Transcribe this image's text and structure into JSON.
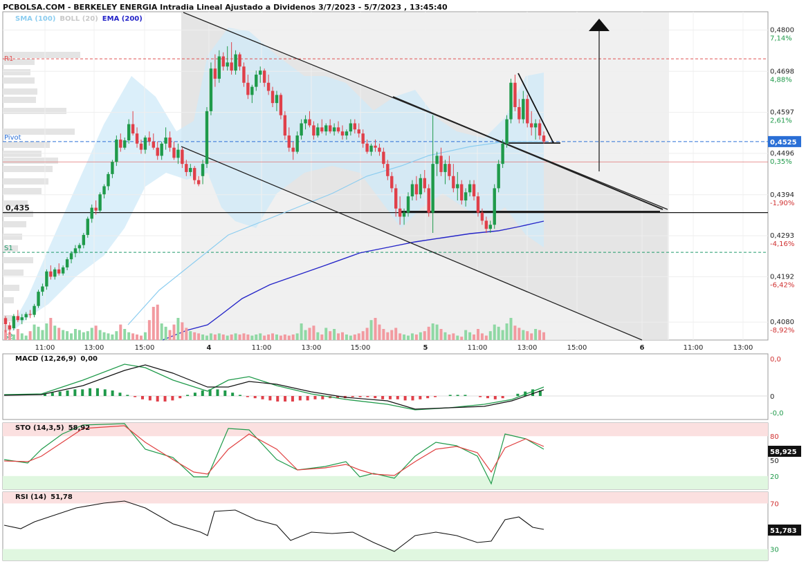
{
  "title": "PCBOLSA.COM - BERKELEY ENERGIA Intradia Lineal Ajustado a Dividenos 3/7/2023 - 5/7/2023 , 13:45:40",
  "legend": [
    {
      "label": "SMA (100)",
      "color": "#8ccdf0"
    },
    {
      "label": "BOLL (20)",
      "color": "#c8c8c8"
    },
    {
      "label": "EMA (200)",
      "color": "#2222cc"
    }
  ],
  "colors": {
    "up": "#1f9a4a",
    "down": "#e0404a",
    "sma": "#8ccdf0",
    "ema": "#2424c8",
    "pivot": "#2a6fd6",
    "r1": "#e05050",
    "s1": "#1f9a6a"
  },
  "chart_data": [
    {
      "type": "candlestick",
      "ylim": [
        0.4036,
        0.4845
      ],
      "y_ticks": [
        "0,4800",
        "0,4698",
        "0,4597",
        "0,4496",
        "0,4394",
        "0,4293",
        "0,4192",
        "0,4080"
      ],
      "percent_ticks": [
        "7,14%",
        "4,88%",
        "2,61%",
        "0,35%",
        "-1,90%",
        "-4,16%",
        "-6,42%",
        "-8,92%"
      ],
      "x_ticks": [
        "11:00",
        "13:00",
        "15:00",
        "4",
        "11:00",
        "13:00",
        "15:00",
        "5",
        "11:00",
        "13:00",
        "15:00",
        "6",
        "11:00",
        "13:00"
      ],
      "last_price": "0,4525",
      "levels": [
        {
          "label": "R1",
          "value": 0.4729
        },
        {
          "label": "Pivot",
          "value": 0.4525
        },
        {
          "label": "0,435",
          "value": 0.435
        },
        {
          "label": "S1",
          "value": 0.4252
        },
        {
          "label": "S2",
          "value": 0.4045
        }
      ],
      "ohlc": [
        [
          0.409,
          0.4095,
          0.4055,
          0.4075
        ],
        [
          0.4072,
          0.408,
          0.405,
          0.4062
        ],
        [
          0.4065,
          0.41,
          0.406,
          0.4095
        ],
        [
          0.4095,
          0.411,
          0.408,
          0.4085
        ],
        [
          0.4085,
          0.41,
          0.4075,
          0.4092
        ],
        [
          0.4092,
          0.4105,
          0.4085,
          0.41
        ],
        [
          0.41,
          0.411,
          0.409,
          0.4098
        ],
        [
          0.4098,
          0.4125,
          0.4092,
          0.412
        ],
        [
          0.412,
          0.416,
          0.4115,
          0.4155
        ],
        [
          0.4155,
          0.4175,
          0.4145,
          0.4168
        ],
        [
          0.4168,
          0.421,
          0.416,
          0.4205
        ],
        [
          0.4205,
          0.422,
          0.4185,
          0.4192
        ],
        [
          0.4192,
          0.4215,
          0.4185,
          0.421
        ],
        [
          0.421,
          0.4225,
          0.4195,
          0.42
        ],
        [
          0.42,
          0.422,
          0.4195,
          0.4215
        ],
        [
          0.4215,
          0.424,
          0.4208,
          0.4235
        ],
        [
          0.4235,
          0.4255,
          0.4225,
          0.425
        ],
        [
          0.425,
          0.427,
          0.424,
          0.4262
        ],
        [
          0.4262,
          0.4275,
          0.425,
          0.427
        ],
        [
          0.427,
          0.43,
          0.4262,
          0.4295
        ],
        [
          0.4295,
          0.434,
          0.4288,
          0.4335
        ],
        [
          0.4335,
          0.437,
          0.4325,
          0.4362
        ],
        [
          0.4362,
          0.438,
          0.4345,
          0.4355
        ],
        [
          0.4355,
          0.44,
          0.435,
          0.4395
        ],
        [
          0.4395,
          0.442,
          0.4385,
          0.4415
        ],
        [
          0.4415,
          0.445,
          0.4405,
          0.4445
        ],
        [
          0.4445,
          0.448,
          0.4435,
          0.4475
        ],
        [
          0.4475,
          0.454,
          0.4465,
          0.453
        ],
        [
          0.453,
          0.4545,
          0.45,
          0.451
        ],
        [
          0.451,
          0.4535,
          0.4505,
          0.4528
        ],
        [
          0.4528,
          0.458,
          0.452,
          0.4568
        ],
        [
          0.4568,
          0.46,
          0.454,
          0.4545
        ],
        [
          0.4545,
          0.456,
          0.451,
          0.452
        ],
        [
          0.452,
          0.453,
          0.4495,
          0.4505
        ],
        [
          0.4505,
          0.454,
          0.4495,
          0.4535
        ],
        [
          0.4535,
          0.455,
          0.4515,
          0.4525
        ],
        [
          0.4525,
          0.4545,
          0.4505,
          0.451
        ],
        [
          0.451,
          0.4525,
          0.448,
          0.449
        ],
        [
          0.449,
          0.4525,
          0.448,
          0.452
        ],
        [
          0.452,
          0.456,
          0.4505,
          0.4535
        ],
        [
          0.4535,
          0.455,
          0.45,
          0.451
        ],
        [
          0.451,
          0.4525,
          0.448,
          0.4485
        ],
        [
          0.4485,
          0.452,
          0.447,
          0.4505
        ],
        [
          0.4505,
          0.451,
          0.446,
          0.447
        ],
        [
          0.447,
          0.448,
          0.444,
          0.445
        ],
        [
          0.445,
          0.447,
          0.444,
          0.446
        ],
        [
          0.446,
          0.4465,
          0.442,
          0.443
        ],
        [
          0.443,
          0.444,
          0.4415,
          0.442
        ],
        [
          0.444,
          0.448,
          0.442,
          0.447
        ],
        [
          0.447,
          0.461,
          0.446,
          0.46
        ],
        [
          0.46,
          0.472,
          0.459,
          0.4705
        ],
        [
          0.4705,
          0.474,
          0.466,
          0.468
        ],
        [
          0.468,
          0.475,
          0.467,
          0.4735
        ],
        [
          0.4735,
          0.4745,
          0.47,
          0.471
        ],
        [
          0.471,
          0.476,
          0.47,
          0.472
        ],
        [
          0.472,
          0.477,
          0.469,
          0.47
        ],
        [
          0.47,
          0.475,
          0.469,
          0.474
        ],
        [
          0.474,
          0.4745,
          0.47,
          0.471
        ],
        [
          0.471,
          0.472,
          0.466,
          0.467
        ],
        [
          0.467,
          0.469,
          0.463,
          0.464
        ],
        [
          0.464,
          0.4665,
          0.462,
          0.466
        ],
        [
          0.466,
          0.47,
          0.465,
          0.469
        ],
        [
          0.469,
          0.471,
          0.467,
          0.47
        ],
        [
          0.47,
          0.4705,
          0.466,
          0.467
        ],
        [
          0.467,
          0.469,
          0.464,
          0.465
        ],
        [
          0.465,
          0.466,
          0.461,
          0.462
        ],
        [
          0.462,
          0.465,
          0.46,
          0.464
        ],
        [
          0.464,
          0.4645,
          0.458,
          0.459
        ],
        [
          0.459,
          0.46,
          0.453,
          0.454
        ],
        [
          0.454,
          0.456,
          0.45,
          0.451
        ],
        [
          0.451,
          0.4525,
          0.448,
          0.45
        ],
        [
          0.45,
          0.455,
          0.4495,
          0.454
        ],
        [
          0.454,
          0.458,
          0.453,
          0.457
        ],
        [
          0.457,
          0.459,
          0.4555,
          0.458
        ],
        [
          0.458,
          0.46,
          0.456,
          0.4565
        ],
        [
          0.4565,
          0.4575,
          0.453,
          0.454
        ],
        [
          0.454,
          0.457,
          0.4535,
          0.456
        ],
        [
          0.456,
          0.458,
          0.4545,
          0.455
        ],
        [
          0.455,
          0.457,
          0.454,
          0.4565
        ],
        [
          0.4565,
          0.458,
          0.4545,
          0.455
        ],
        [
          0.455,
          0.457,
          0.454,
          0.456
        ],
        [
          0.456,
          0.4575,
          0.4545,
          0.455
        ],
        [
          0.455,
          0.4565,
          0.453,
          0.454
        ],
        [
          0.454,
          0.4555,
          0.453,
          0.455
        ],
        [
          0.455,
          0.458,
          0.454,
          0.457
        ],
        [
          0.457,
          0.458,
          0.4545,
          0.4555
        ],
        [
          0.4555,
          0.457,
          0.4535,
          0.4545
        ],
        [
          0.4545,
          0.4555,
          0.451,
          0.452
        ],
        [
          0.452,
          0.453,
          0.4495,
          0.45
        ],
        [
          0.45,
          0.452,
          0.449,
          0.4515
        ],
        [
          0.4515,
          0.453,
          0.45,
          0.451
        ],
        [
          0.451,
          0.452,
          0.449,
          0.45
        ],
        [
          0.45,
          0.451,
          0.446,
          0.447
        ],
        [
          0.447,
          0.448,
          0.443,
          0.444
        ],
        [
          0.444,
          0.445,
          0.44,
          0.441
        ],
        [
          0.441,
          0.442,
          0.434,
          0.436
        ],
        [
          0.436,
          0.439,
          0.432,
          0.434
        ],
        [
          0.434,
          0.436,
          0.432,
          0.435
        ],
        [
          0.435,
          0.44,
          0.434,
          0.439
        ],
        [
          0.439,
          0.443,
          0.438,
          0.442
        ],
        [
          0.442,
          0.444,
          0.438,
          0.4395
        ],
        [
          0.4395,
          0.4445,
          0.4385,
          0.4435
        ],
        [
          0.4435,
          0.4455,
          0.44,
          0.441
        ],
        [
          0.441,
          0.442,
          0.434,
          0.435
        ],
        [
          0.435,
          0.459,
          0.43,
          0.447
        ],
        [
          0.447,
          0.45,
          0.444,
          0.449
        ],
        [
          0.449,
          0.451,
          0.444,
          0.445
        ],
        [
          0.445,
          0.448,
          0.442,
          0.447
        ],
        [
          0.447,
          0.449,
          0.443,
          0.444
        ],
        [
          0.444,
          0.447,
          0.44,
          0.441
        ],
        [
          0.441,
          0.445,
          0.438,
          0.442
        ],
        [
          0.442,
          0.443,
          0.437,
          0.438
        ],
        [
          0.438,
          0.441,
          0.4365,
          0.44
        ],
        [
          0.44,
          0.443,
          0.439,
          0.442
        ],
        [
          0.442,
          0.443,
          0.438,
          0.439
        ],
        [
          0.439,
          0.44,
          0.434,
          0.435
        ],
        [
          0.435,
          0.436,
          0.432,
          0.433
        ],
        [
          0.433,
          0.434,
          0.43,
          0.431
        ],
        [
          0.431,
          0.433,
          0.43,
          0.432
        ],
        [
          0.432,
          0.442,
          0.431,
          0.441
        ],
        [
          0.441,
          0.448,
          0.44,
          0.447
        ],
        [
          0.447,
          0.453,
          0.446,
          0.452
        ],
        [
          0.452,
          0.459,
          0.451,
          0.458
        ],
        [
          0.458,
          0.468,
          0.457,
          0.467
        ],
        [
          0.467,
          0.469,
          0.46,
          0.461
        ],
        [
          0.461,
          0.463,
          0.457,
          0.458
        ],
        [
          0.458,
          0.465,
          0.457,
          0.463
        ],
        [
          0.463,
          0.464,
          0.456,
          0.457
        ],
        [
          0.457,
          0.46,
          0.454,
          0.456
        ],
        [
          0.456,
          0.458,
          0.453,
          0.457
        ],
        [
          0.457,
          0.458,
          0.453,
          0.454
        ],
        [
          0.454,
          0.455,
          0.452,
          0.4525
        ]
      ]
    },
    {
      "type": "line",
      "title": "MACD (12,26,9)",
      "value": "0,00",
      "ylim": [
        -0.0035,
        0.0035
      ],
      "y_ticks": [
        "0,0",
        "0",
        "-0,0"
      ]
    },
    {
      "type": "line",
      "title": "STO (14,3,5)",
      "value": "58,92",
      "ylim": [
        0,
        100
      ],
      "y_ticks": [
        "80",
        "50",
        "20"
      ],
      "last_value": "58,925"
    },
    {
      "type": "line",
      "title": "RSI (14)",
      "value": "51,78",
      "ylim": [
        20,
        80
      ],
      "y_ticks": [
        "70",
        "30"
      ],
      "last_value": "51,783"
    }
  ]
}
